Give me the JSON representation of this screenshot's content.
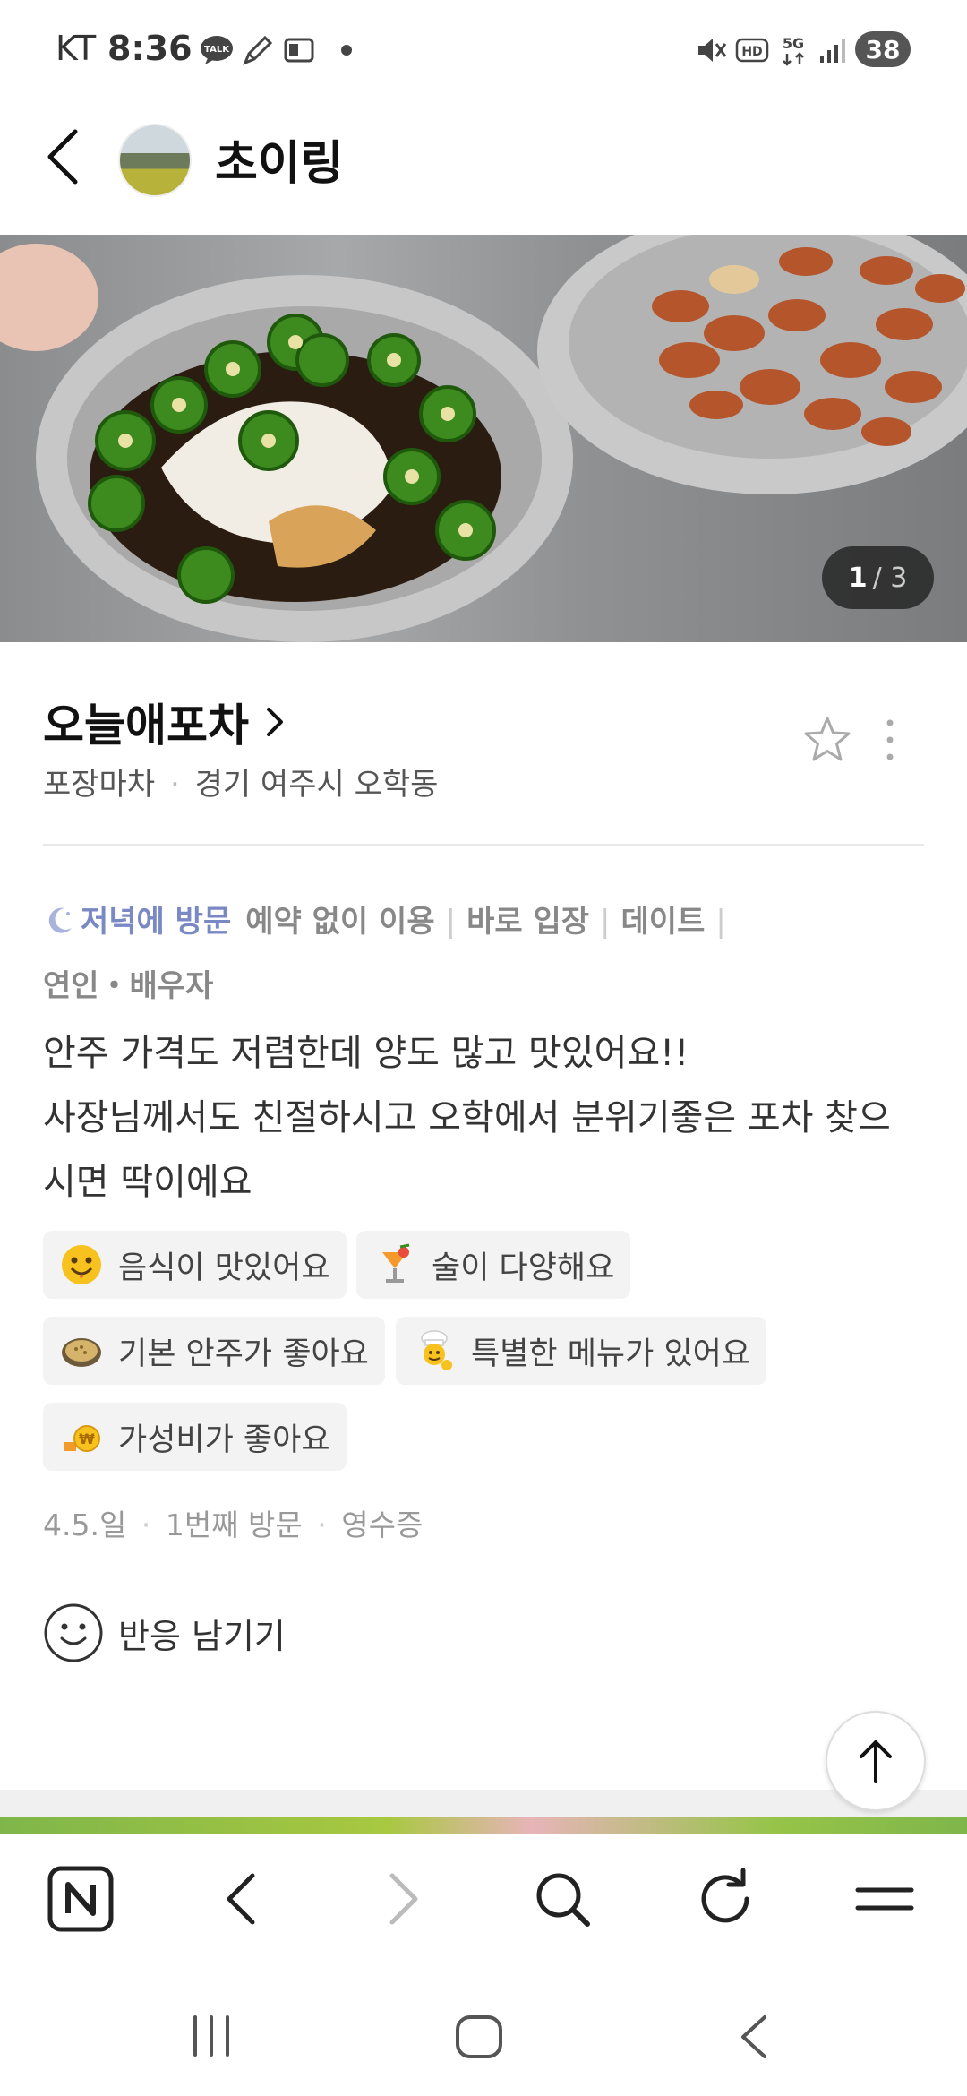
{
  "status_bar": {
    "carrier": "KT",
    "time": "8:36",
    "talk_badge": "TALK",
    "hd_label": "HD",
    "network_label": "5G",
    "battery": "38"
  },
  "header": {
    "back_label": "back",
    "profile_name": "초이링"
  },
  "photo": {
    "current": "1",
    "total": "/ 3"
  },
  "place": {
    "name": "오늘애포차",
    "category": "포장마차",
    "location": "경기 여주시 오학동"
  },
  "visit_tags": {
    "time_of_visit": "저녁에 방문",
    "tags": [
      "예약 없이 이용",
      "바로 입장",
      "데이트"
    ],
    "companion": "연인・배우자"
  },
  "review": {
    "text_lines": [
      "안주 가격도 저렴한데 양도 많고 맛있어요!!",
      "사장님께서도 친절하시고 오학에서 분위기좋은 포차 찾으",
      "시면 딱이에요"
    ],
    "keywords": [
      {
        "label": "음식이 맛있어요",
        "icon": "smiley-emoji-icon"
      },
      {
        "label": "술이 다양해요",
        "icon": "cocktail-emoji-icon"
      },
      {
        "label": "기본 안주가 좋아요",
        "icon": "snack-plate-emoji-icon"
      },
      {
        "label": "특별한 메뉴가 있어요",
        "icon": "chef-emoji-icon"
      },
      {
        "label": "가성비가 좋아요",
        "icon": "coin-emoji-icon"
      }
    ]
  },
  "visit_info": {
    "date": "4.5.일",
    "visit_count": "1번째 방문",
    "verification": "영수증"
  },
  "reaction": {
    "label": "반응 남기기"
  },
  "colors": {
    "accent": "#7a89c4",
    "text": "#222222",
    "muted": "#999999",
    "chip_bg": "#f3f3f3"
  }
}
